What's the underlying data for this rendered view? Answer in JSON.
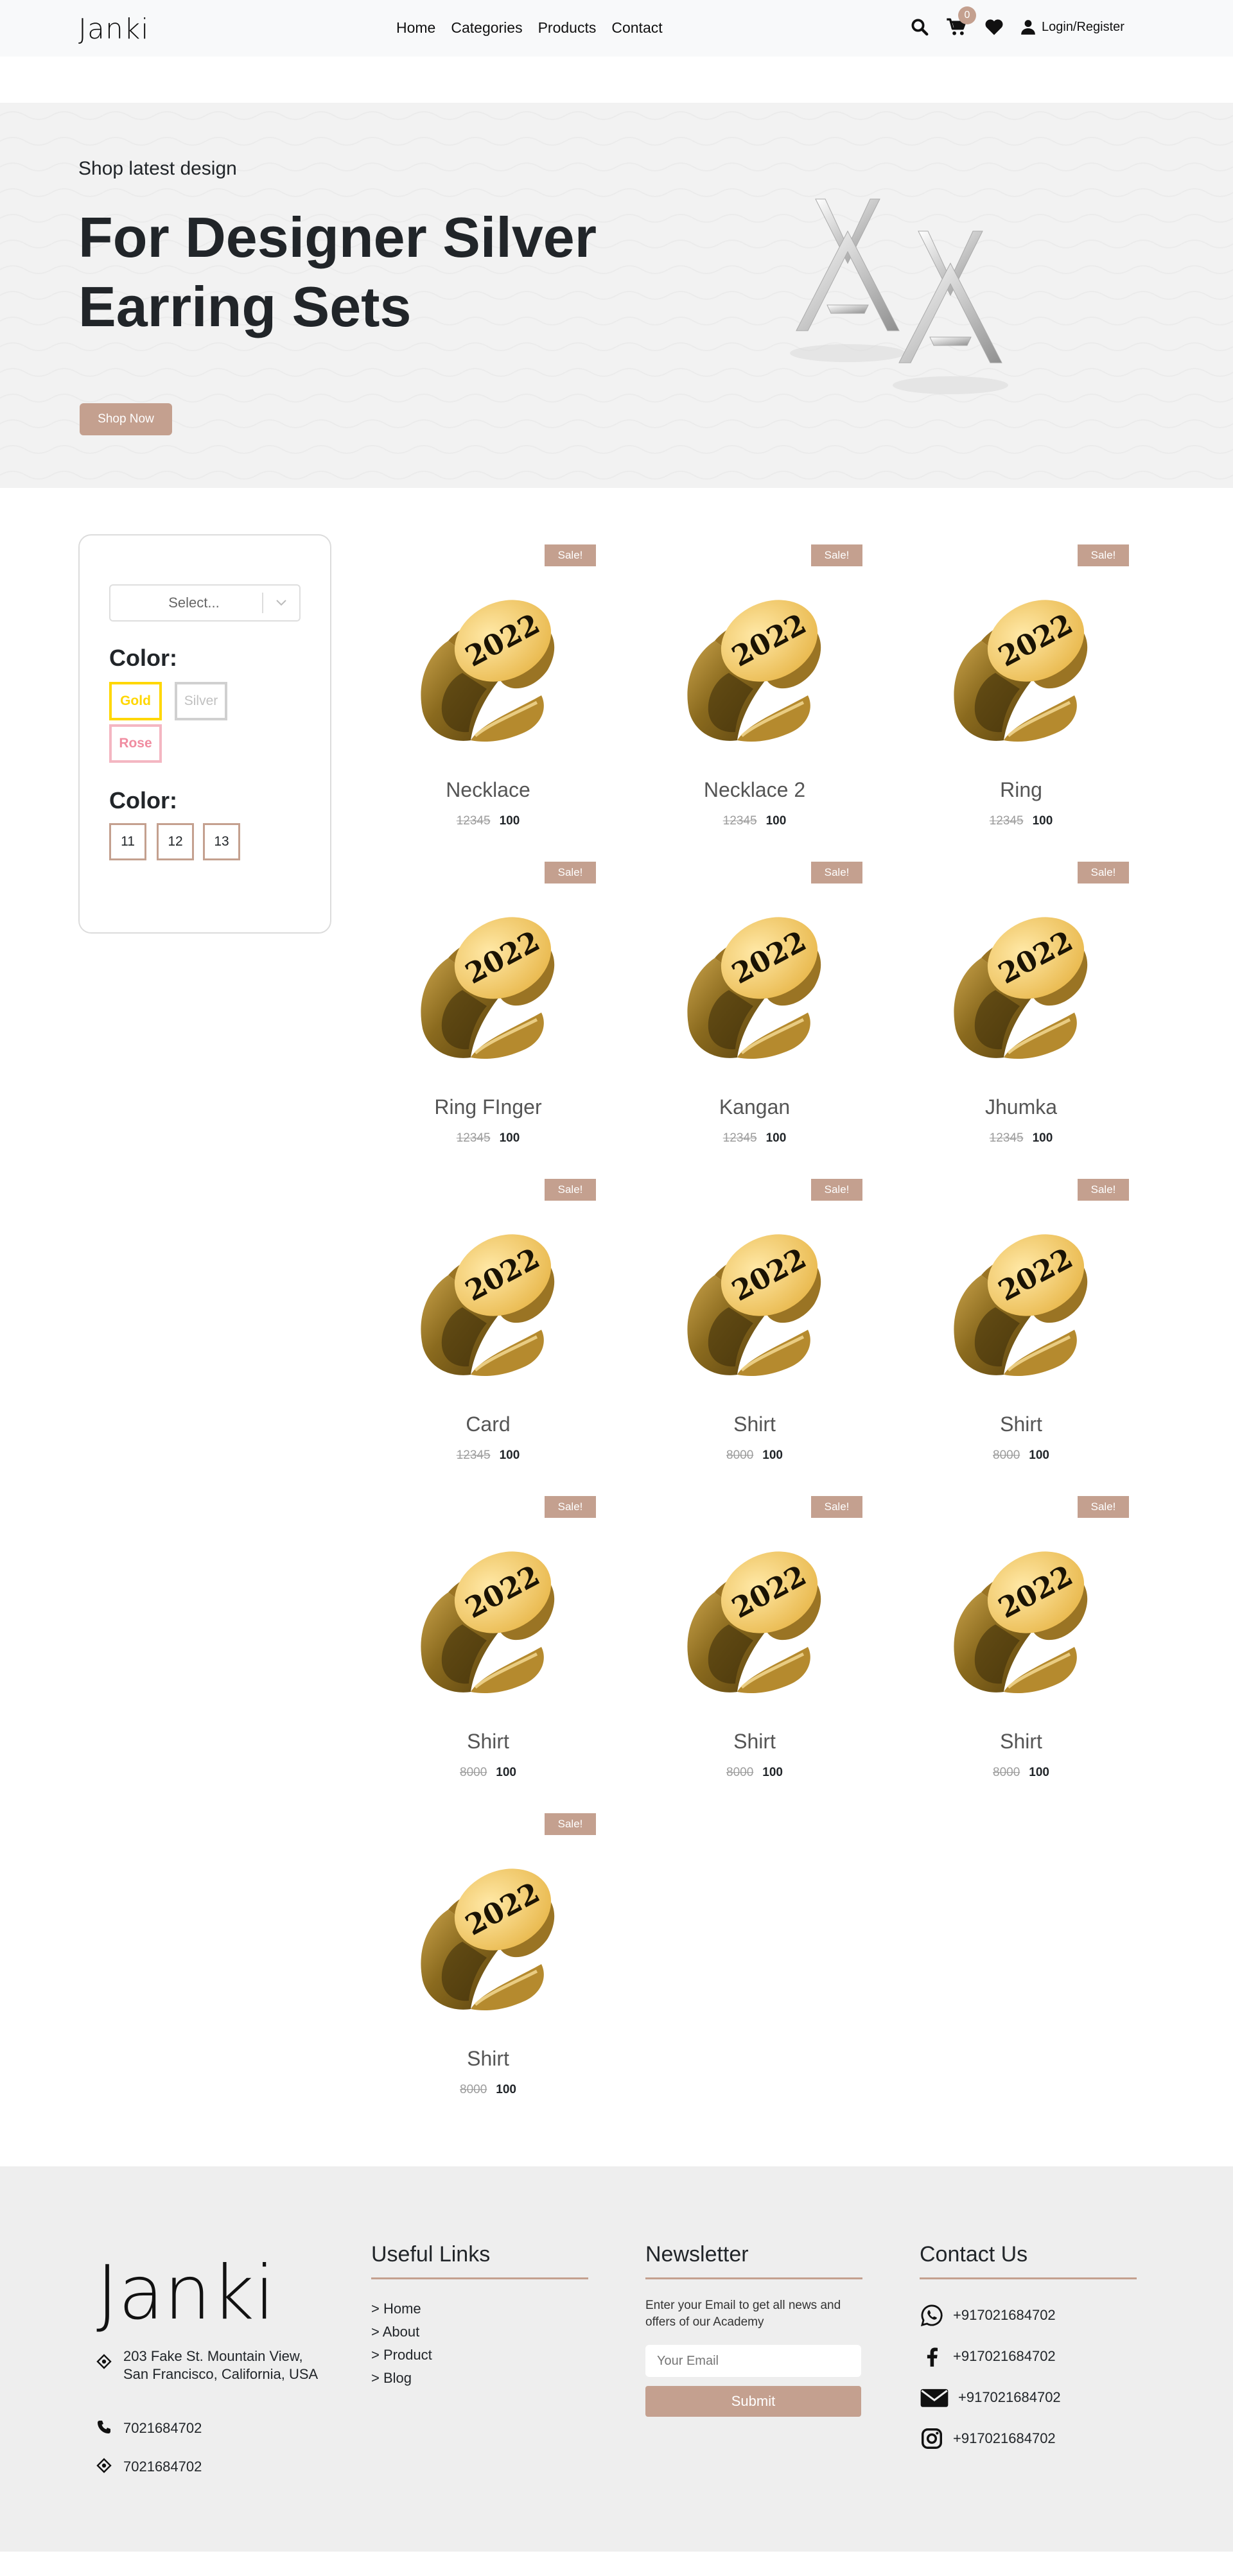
{
  "header": {
    "logo": "Janki",
    "nav": [
      "Home",
      "Categories",
      "Products",
      "Contact"
    ],
    "cart_count": "0",
    "login_label": "Login/Register"
  },
  "hero": {
    "subtitle": "Shop latest design",
    "title": "For Designer Silver Earring Sets",
    "button": "Shop Now"
  },
  "filter": {
    "select_value": "Select...",
    "color_heading": "Color:",
    "colors": [
      {
        "label": "Gold",
        "color": "#ffd700"
      },
      {
        "label": "Silver",
        "color": "#c0c0c0"
      },
      {
        "label": "Rose",
        "color": "#f4b6c2"
      }
    ],
    "size_heading": "Color:",
    "sizes": [
      "11",
      "12",
      "13"
    ]
  },
  "products": [
    {
      "name": "Necklace",
      "old_price": "12345",
      "price": "100",
      "badge": "Sale!"
    },
    {
      "name": "Necklace 2",
      "old_price": "12345",
      "price": "100",
      "badge": "Sale!"
    },
    {
      "name": "Ring",
      "old_price": "12345",
      "price": "100",
      "badge": "Sale!"
    },
    {
      "name": "Ring FInger",
      "old_price": "12345",
      "price": "100",
      "badge": "Sale!"
    },
    {
      "name": "Kangan",
      "old_price": "12345",
      "price": "100",
      "badge": "Sale!"
    },
    {
      "name": "Jhumka",
      "old_price": "12345",
      "price": "100",
      "badge": "Sale!"
    },
    {
      "name": "Card",
      "old_price": "12345",
      "price": "100",
      "badge": "Sale!"
    },
    {
      "name": "Shirt",
      "old_price": "8000",
      "price": "100",
      "badge": "Sale!"
    },
    {
      "name": "Shirt",
      "old_price": "8000",
      "price": "100",
      "badge": "Sale!"
    },
    {
      "name": "Shirt",
      "old_price": "8000",
      "price": "100",
      "badge": "Sale!"
    },
    {
      "name": "Shirt",
      "old_price": "8000",
      "price": "100",
      "badge": "Sale!"
    },
    {
      "name": "Shirt",
      "old_price": "8000",
      "price": "100",
      "badge": "Sale!"
    },
    {
      "name": "Shirt",
      "old_price": "8000",
      "price": "100",
      "badge": "Sale!"
    }
  ],
  "product_image_text": "2022",
  "footer": {
    "logo": "Janki",
    "address": "203 Fake St. Mountain View, San Francisco, California, USA",
    "phone": "7021684702",
    "phone2": "7021684702",
    "useful_links_title": "Useful Links",
    "useful_links": [
      "> Home",
      "> About",
      "> Product",
      "> Blog"
    ],
    "newsletter_title": "Newsletter",
    "newsletter_text": "Enter your Email to get all news and offers of our Academy",
    "email_placeholder": "Your Email",
    "submit_label": "Submit",
    "contact_title": "Contact Us",
    "contacts": [
      {
        "icon": "whatsapp-icon",
        "value": "+917021684702"
      },
      {
        "icon": "facebook-icon",
        "value": "+917021684702"
      },
      {
        "icon": "mail-icon",
        "value": "+917021684702"
      },
      {
        "icon": "instagram-icon",
        "value": "+917021684702"
      }
    ]
  },
  "colors": {
    "accent": "#c4a08f",
    "header_bg": "#f8f9fa",
    "hero_bg": "#f2f2f2",
    "footer_bg": "#eeeeee"
  }
}
